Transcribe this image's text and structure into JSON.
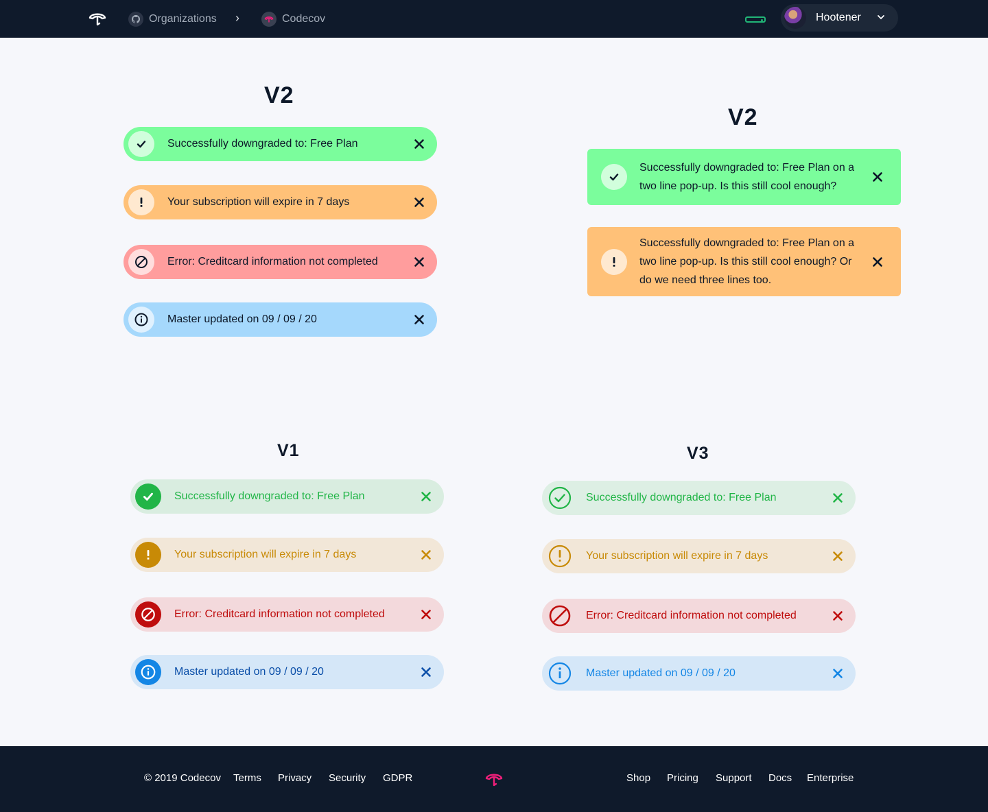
{
  "header": {
    "breadcrumb_1": "Organizations",
    "breadcrumb_sep": "›",
    "breadcrumb_2": "Codecov",
    "user_name": "Hootener"
  },
  "headings": {
    "v2_left": "V2",
    "v2_right": "V2",
    "v1": "V1",
    "v3": "V3"
  },
  "v2_pills": [
    {
      "kind": "success",
      "message": "Successfully downgraded to: Free Plan",
      "bg": "#7bfd9c",
      "fg": "#0d1829"
    },
    {
      "kind": "warning",
      "message": "Your subscription will expire in 7 days",
      "bg": "#ffc178",
      "fg": "#0d1829"
    },
    {
      "kind": "error",
      "message": "Error: Creditcard information not completed",
      "bg": "#ff9d9d",
      "fg": "#0d1829"
    },
    {
      "kind": "info",
      "message": "Master updated on 09 / 09 / 20",
      "bg": "#a5d8fc",
      "fg": "#0d1829"
    }
  ],
  "v2_cards": [
    {
      "kind": "success",
      "message_line1": "Successfully downgraded to: Free Plan on a",
      "message_line2": "two line pop-up. Is this still cool enough?",
      "bg": "#7bfd9c"
    },
    {
      "kind": "warning",
      "message_line1": "Successfully downgraded to: Free Plan on a",
      "message_line2": "two line pop-up. Is this still cool enough? Or",
      "message_line3": "do we need three lines too.",
      "bg": "#ffc178"
    }
  ],
  "v1_pills": [
    {
      "kind": "success",
      "message": "Successfully downgraded to: Free Plan",
      "bg": "#d9ede0",
      "fg": "#21b547"
    },
    {
      "kind": "warning",
      "message": "Your subscription will expire in 7 days",
      "bg": "#f2e7d8",
      "fg": "#c88a06"
    },
    {
      "kind": "error",
      "message": "Error: Creditcard information not completed",
      "bg": "#f3d9dc",
      "fg": "#bf0d0d"
    },
    {
      "kind": "info",
      "message": "Master updated on 09 / 09 / 20",
      "bg": "#d5e7f8",
      "fg": "#0a4ea8"
    }
  ],
  "v3_pills": [
    {
      "kind": "success",
      "message": "Successfully downgraded to: Free Plan",
      "bg": "#ddefe4",
      "fg": "#21b547"
    },
    {
      "kind": "warning",
      "message": "Your subscription will expire in 7 days",
      "bg": "#f2e7d8",
      "fg": "#c88a06"
    },
    {
      "kind": "error",
      "message": "Error: Creditcard information not completed",
      "bg": "#f3d9dc",
      "fg": "#bf0d0d"
    },
    {
      "kind": "info",
      "message": "Master updated on 09 / 09 / 20",
      "bg": "#d5e7f8",
      "fg": "#1486e5"
    }
  ],
  "footer": {
    "copyright": "© 2019 Codecov",
    "links_left": [
      "Terms",
      "Privacy",
      "Security",
      "GDPR"
    ],
    "links_right": [
      "Shop",
      "Pricing",
      "Support",
      "Docs",
      "Enterprise"
    ]
  },
  "colors": {
    "topbar": "#0f1a2b",
    "accent_pink": "#f01f7a",
    "status_green": "#21b577"
  },
  "icons": {
    "success": "check-icon",
    "warning": "exclamation-icon",
    "error": "ban-icon",
    "info": "info-icon",
    "close": "close-icon"
  }
}
